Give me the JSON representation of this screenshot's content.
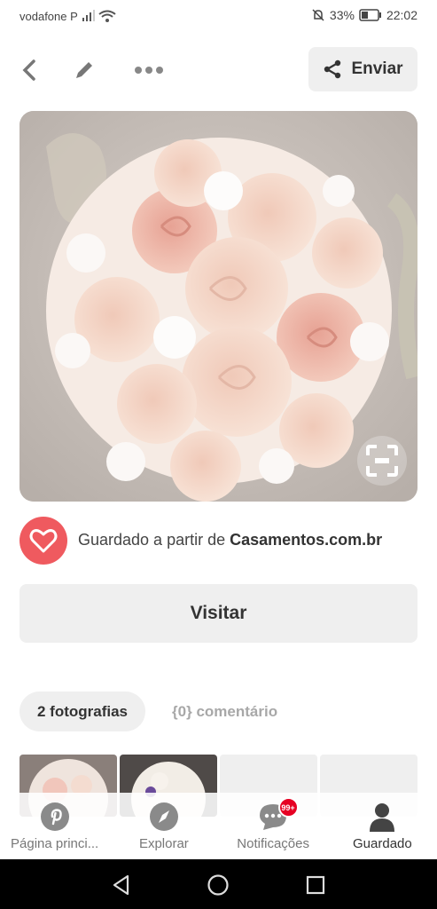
{
  "status_bar": {
    "carrier": "vodafone P",
    "battery": "33%",
    "time": "22:02"
  },
  "topbar": {
    "back_icon": "chevron-left-icon",
    "edit_icon": "pencil-icon",
    "more_icon": "more-horizontal-icon",
    "send_label": "Enviar"
  },
  "source": {
    "prefix": "Guardado a partir de ",
    "site": "Casamentos.com.br"
  },
  "visit_label": "Visitar",
  "tabs": [
    {
      "label": "2 fotografias"
    },
    {
      "label": "{0} comentário"
    }
  ],
  "nav": [
    {
      "label": "Página princi...",
      "icon": "pinterest-icon"
    },
    {
      "label": "Explorar",
      "icon": "compass-icon"
    },
    {
      "label": "Notificações",
      "icon": "chat-bubble-icon",
      "badge": "99+"
    },
    {
      "label": "Guardado",
      "icon": "person-icon"
    }
  ],
  "colors": {
    "brand": "#e60023",
    "source_logo": "#ef5a5f",
    "button_bg": "#efefef"
  }
}
